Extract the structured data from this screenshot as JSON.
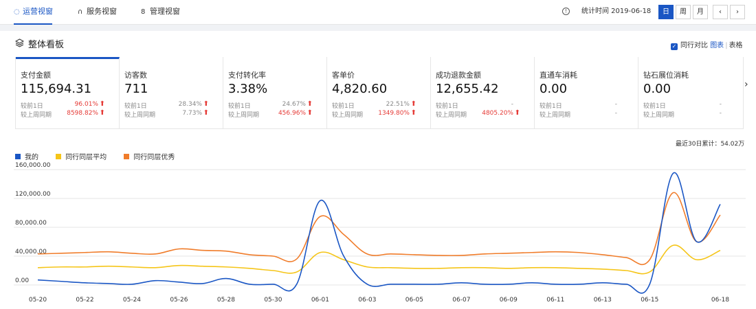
{
  "nav": {
    "tabs": [
      {
        "label": "运营视窗",
        "icon": "dashboard-icon"
      },
      {
        "label": "服务视窗",
        "icon": "headset-icon"
      },
      {
        "label": "管理视窗",
        "icon": "manage-icon"
      }
    ],
    "stat_time": "统计时间 2019-06-18",
    "period": [
      "日",
      "周",
      "月"
    ],
    "prev": "‹",
    "next": "›"
  },
  "panel": {
    "title": "整体看板",
    "peer_compare": "同行对比",
    "view_chart": "图表",
    "view_sep": "|",
    "view_table": "表格",
    "cumulative": "最近30日累计：54.02万",
    "more_arrow": "›"
  },
  "cards": [
    {
      "label": "支付金额",
      "value": "115,694.31",
      "c1": "较前1日",
      "v1": "96.01%",
      "c2": "较上周同期",
      "v2": "8598.82%"
    },
    {
      "label": "访客数",
      "value": "711",
      "c1": "较前1日",
      "v1": "28.34%",
      "c2": "较上周同期",
      "v2": "7.73%"
    },
    {
      "label": "支付转化率",
      "value": "3.38%",
      "c1": "较前1日",
      "v1": "24.67%",
      "c2": "较上周同期",
      "v2": "456.96%"
    },
    {
      "label": "客单价",
      "value": "4,820.60",
      "c1": "较前1日",
      "v1": "22.51%",
      "c2": "较上周同期",
      "v2": "1349.80%"
    },
    {
      "label": "成功退款金额",
      "value": "12,655.42",
      "c1": "较前1日",
      "v1": "-",
      "c2": "较上周同期",
      "v2": "4805.20%"
    },
    {
      "label": "直通车消耗",
      "value": "0.00",
      "c1": "较前1日",
      "v1": "-",
      "c2": "较上周同期",
      "v2": "-"
    },
    {
      "label": "钻石展位消耗",
      "value": "0.00",
      "c1": "较前1日",
      "v1": "-",
      "c2": "较上周同期",
      "v2": "-"
    }
  ],
  "chart_data": {
    "type": "line",
    "x": [
      "05-20",
      "05-21",
      "05-22",
      "05-23",
      "05-24",
      "05-25",
      "05-26",
      "05-27",
      "05-28",
      "05-29",
      "05-30",
      "05-31",
      "06-01",
      "06-02",
      "06-03",
      "06-04",
      "06-05",
      "06-06",
      "06-07",
      "06-08",
      "06-09",
      "06-10",
      "06-11",
      "06-12",
      "06-13",
      "06-14",
      "06-15",
      "06-16",
      "06-17",
      "06-18"
    ],
    "x_tick_labels": [
      "05-20",
      "05-22",
      "05-24",
      "05-26",
      "05-28",
      "05-30",
      "06-01",
      "06-03",
      "06-05",
      "06-07",
      "06-09",
      "06-11",
      "06-13",
      "06-15",
      "06-18"
    ],
    "y_tick_labels": [
      "0.00",
      "40,000.00",
      "80,000.00",
      "120,000.00",
      "160,000.00"
    ],
    "ylim": [
      0,
      160000
    ],
    "grid": true,
    "legend_position": "top-left",
    "series": [
      {
        "name": "我的",
        "color": "#1a56c4",
        "values": [
          7000,
          5000,
          3000,
          2000,
          1000,
          6000,
          4000,
          2000,
          9000,
          1000,
          1000,
          1000,
          117000,
          40000,
          1000,
          1000,
          1000,
          1000,
          3000,
          1000,
          1000,
          3000,
          1000,
          1000,
          3000,
          1000,
          1000,
          155000,
          60000,
          112000
        ]
      },
      {
        "name": "同行同层平均",
        "color": "#f5c518",
        "values": [
          24000,
          25000,
          25000,
          26000,
          25000,
          24000,
          27000,
          26000,
          25000,
          23000,
          20000,
          18000,
          45000,
          35000,
          25000,
          24000,
          23000,
          23000,
          24000,
          24000,
          23000,
          24000,
          24000,
          23000,
          22000,
          20000,
          18000,
          55000,
          35000,
          48000
        ]
      },
      {
        "name": "同行同层优秀",
        "color": "#f07c2a",
        "values": [
          43000,
          44000,
          45000,
          46000,
          44000,
          43000,
          50000,
          48000,
          47000,
          42000,
          40000,
          36000,
          95000,
          70000,
          43000,
          43000,
          42000,
          41000,
          41000,
          43000,
          44000,
          45000,
          46000,
          45000,
          42000,
          38000,
          35000,
          128000,
          60000,
          97000
        ]
      }
    ]
  }
}
